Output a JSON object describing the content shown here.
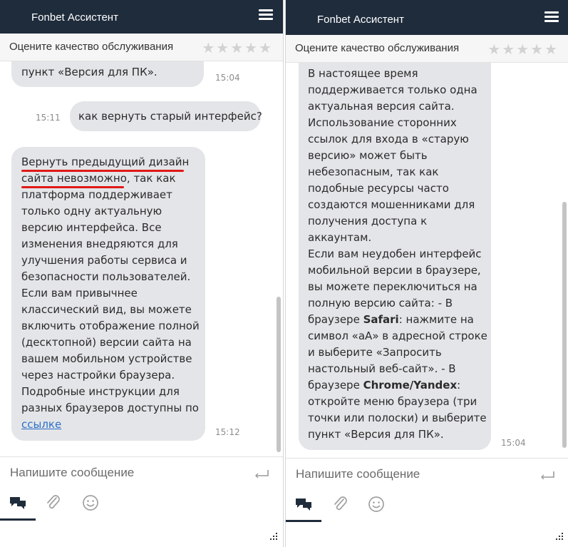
{
  "app": {
    "title": "Fonbet Ассистент",
    "rating_label": "Оцените качество обслуживания",
    "stars": "★★★★★",
    "composer_placeholder": "Напишите сообщение",
    "icons": [
      "menu-icon",
      "star-icon",
      "enter-icon",
      "chat-icon",
      "attach-icon",
      "smile-icon",
      "resize-icon"
    ],
    "colors": {
      "header": "#1f2c3c",
      "bubble": "#e4e5e8",
      "link": "#2a6fc9",
      "underline_mark": "#e01818"
    }
  },
  "left": {
    "top_partial": {
      "text": "пункт «Версия для ПК».",
      "time": "15:04"
    },
    "user_message": {
      "text": "как вернуть старый интерфейс?",
      "time": "15:11"
    },
    "bot_reply": {
      "lines": [
        "Вернуть предыдущий дизайн",
        "сайта невозможно",
        ", так как",
        "платформа поддерживает",
        "только одну актуальную",
        "версию интерфейса. Все",
        "изменения внедряются для",
        "улучшения работы сервиса и",
        "безопасности пользователей.",
        "Если вам привычнее",
        "классический вид, вы можете",
        "включить отображение полной",
        "(десктопной) версии сайта на",
        "вашем мобильном устройстве",
        "через настройки браузера.",
        "Подробные инструкции для",
        "разных браузеров доступны по"
      ],
      "link_text": "ссылке",
      "time": "15:12"
    }
  },
  "right": {
    "bot_reply": {
      "lines": [
        "В настоящее время",
        "поддерживается только одна",
        "актуальная версия сайта.",
        "Использование сторонних",
        "ссылок для входа в «старую",
        "версию» может быть",
        "небезопасным, так как",
        "подобные ресурсы часто",
        "создаются мошенниками для",
        "получения доступа к",
        "аккаунтам.",
        "Если вам неудобен интерфейс",
        "мобильной версии в браузере,",
        "вы можете переключиться на",
        "полную версию сайта: - В",
        "браузере ",
        "Safari",
        ": нажмите на",
        "символ «аА» в адресной строке",
        "и выберите «Запросить",
        "настольный веб-сайт». - В",
        "браузере ",
        "Chrome/Yandex",
        ":",
        "откройте меню браузера (три",
        "точки или полоски) и выберите",
        "пункт «Версия для ПК»."
      ],
      "time": "15:04"
    }
  }
}
